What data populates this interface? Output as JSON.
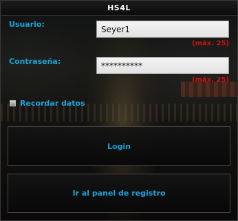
{
  "window": {
    "title": "HS4L"
  },
  "form": {
    "username": {
      "label": "Usuario:",
      "value": "Seyer1",
      "hint": "(máx. 25)"
    },
    "password": {
      "label": "Contraseña:",
      "value": "**********",
      "hint": "(máx. 25)"
    },
    "remember": {
      "label": "Recordar datos",
      "checked": false
    }
  },
  "buttons": {
    "login_label": "Login",
    "register_label": "Ir al panel de registro"
  },
  "colors": {
    "accent": "#1aa3d9",
    "hint": "#d01010",
    "title": "#ffffff"
  }
}
